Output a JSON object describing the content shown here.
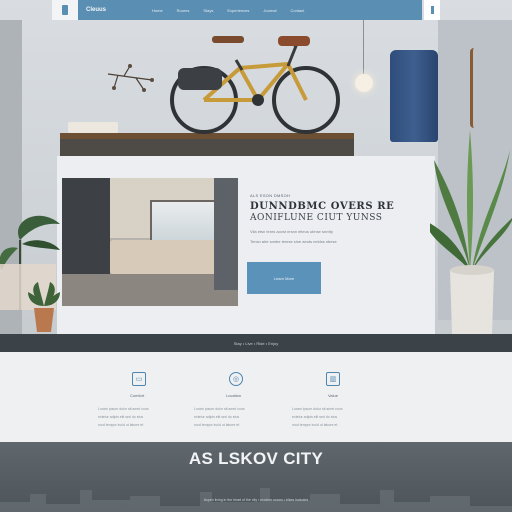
{
  "nav": {
    "brand": "Cleuus",
    "links": [
      "Home",
      "Rooms",
      "Stays",
      "Experiences",
      "Journal",
      "Contact"
    ]
  },
  "hero": {
    "kicker": "ALS ESON DMSOH",
    "title_line1": "DUNNDBMC OVERS RE",
    "title_line2": "AONIFLUNE CIUT YUNSS",
    "sub_line1": "Vila etsn tenrs aovst nrsnn elteus ubnse snrdty",
    "sub_line2": "Tensn alre snnbe tenrse slne aeuts neldss nbese",
    "cta_label": "Learn More"
  },
  "band": {
    "text": "Stay • Live • Ride • Enjoy"
  },
  "features": [
    {
      "icon": "monitor-icon",
      "title": "Comfort",
      "lines": [
        "Loram ipsum dolor sit amet cons",
        "ectetur adipis elit sed do eius",
        "mod tempor incid ut labore et"
      ]
    },
    {
      "icon": "globe-icon",
      "title": "Location",
      "lines": [
        "Loram ipsum dolor sit amet cons",
        "ectetur adipis elit sed do eius",
        "mod tempor incid ut labore et"
      ]
    },
    {
      "icon": "chart-icon",
      "title": "Value",
      "lines": [
        "Loram ipsum dolor sit amet cons",
        "ectetur adipis elit sed do eius",
        "mod tempor incid ut labore et"
      ]
    }
  ],
  "footer": {
    "title": "AS LSKOV CITY",
    "sub": "Aspen living in the heart of the city • modern rooms • bikes included"
  },
  "colors": {
    "accent": "#5b92ba",
    "nav": "#5a8fb3",
    "band": "#3c4348",
    "footer": "#555d63"
  }
}
